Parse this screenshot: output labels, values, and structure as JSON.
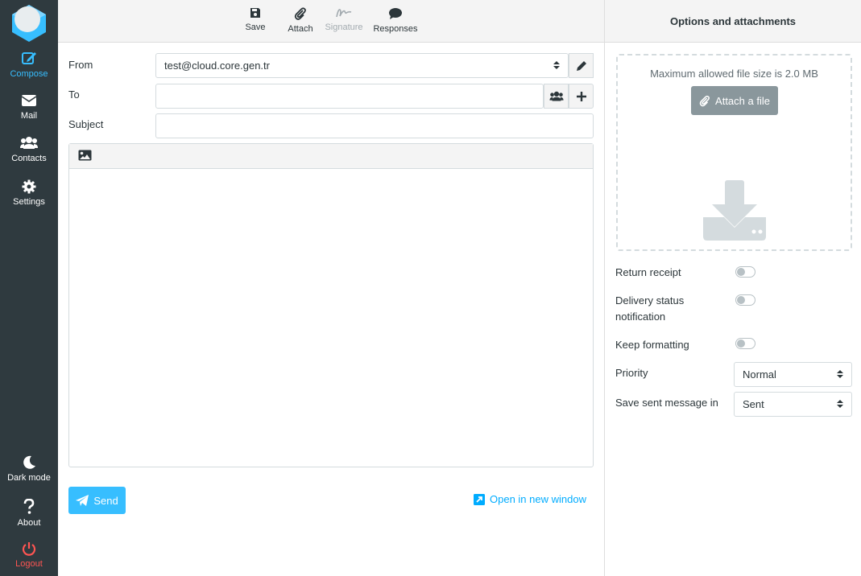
{
  "nav": {
    "compose": "Compose",
    "mail": "Mail",
    "contacts": "Contacts",
    "settings": "Settings",
    "dark_mode": "Dark mode",
    "about": "About",
    "logout": "Logout"
  },
  "toolbar": {
    "save": "Save",
    "attach": "Attach",
    "signature": "Signature",
    "responses": "Responses"
  },
  "compose": {
    "from_label": "From",
    "from_value": "test@cloud.core.gen.tr",
    "to_label": "To",
    "to_value": "",
    "subject_label": "Subject",
    "subject_value": "",
    "send": "Send",
    "open_new_window": "Open in new window"
  },
  "panel": {
    "title": "Options and attachments",
    "max_size": "Maximum allowed file size is 2.0 MB",
    "attach_file": "Attach a file",
    "return_receipt": "Return receipt",
    "delivery_status": "Delivery status notification",
    "keep_formatting": "Keep formatting",
    "priority_label": "Priority",
    "priority_value": "Normal",
    "save_sent_label": "Save sent message in",
    "save_sent_value": "Sent"
  },
  "colors": {
    "accent": "#37beff",
    "nav_bg": "#2f3a3f",
    "logout": "#ff5552",
    "link": "#00acff"
  }
}
